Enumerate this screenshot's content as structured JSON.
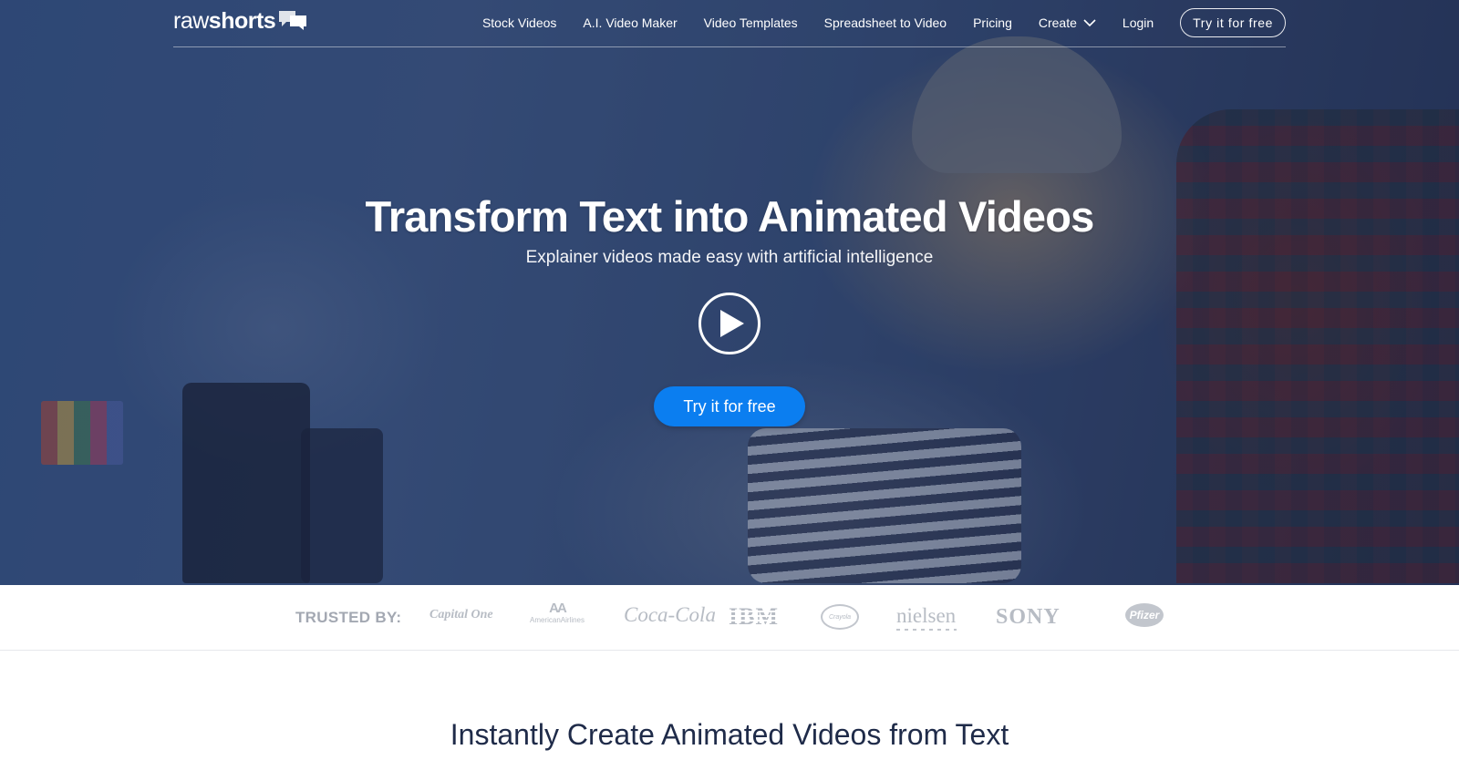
{
  "brand": {
    "logo_part1": "raw",
    "logo_part2": "shorts"
  },
  "nav": {
    "items": [
      {
        "label": "Stock Videos"
      },
      {
        "label": "A.I. Video Maker"
      },
      {
        "label": "Video Templates"
      },
      {
        "label": "Spreadsheet to Video"
      },
      {
        "label": "Pricing"
      },
      {
        "label": "Create",
        "icon": "chevron-down-icon"
      },
      {
        "label": "Login"
      }
    ],
    "cta_label": "Try it for free"
  },
  "hero": {
    "title": "Transform Text into Animated Videos",
    "subtitle": "Explainer videos made easy with artificial intelligence",
    "play_icon": "play-icon",
    "cta_label": "Try it for free"
  },
  "trusted": {
    "label": "TRUSTED BY:",
    "logos": [
      {
        "name": "Capital One",
        "text": "Capital One"
      },
      {
        "name": "American Airlines",
        "text": "AmericanAirlines"
      },
      {
        "name": "Coca-Cola",
        "text": "Coca-Cola"
      },
      {
        "name": "IBM",
        "text": "IBM"
      },
      {
        "name": "Roundel logo",
        "text": "Crayola"
      },
      {
        "name": "Nielsen",
        "text": "nielsen"
      },
      {
        "name": "Sony",
        "text": "SONY"
      },
      {
        "name": "Pfizer",
        "text": "Pfizer"
      }
    ]
  },
  "section": {
    "title": "Instantly Create Animated Videos from Text"
  },
  "colors": {
    "accent": "#0b7ef0",
    "heading_dark": "#1f2b49",
    "logo_gray": "#b7bcc4"
  }
}
